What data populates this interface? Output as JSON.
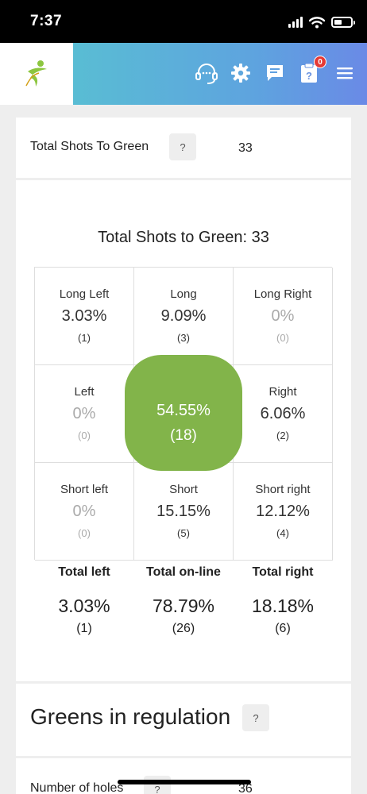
{
  "status_bar": {
    "time": "7:37"
  },
  "header": {
    "icons": [
      "logo-icon",
      "support-headset-icon",
      "gear-icon",
      "chat-icon",
      "help-clipboard-icon",
      "menu-icon"
    ],
    "notification_badge": "0",
    "brand_gradient": [
      "#57c7cf",
      "#6a8ae6"
    ]
  },
  "shots_row": {
    "label": "Total Shots To Green",
    "help": "?",
    "value": "33"
  },
  "chart_data": {
    "type": "table",
    "title": "Total Shots to Green: 33",
    "cells": [
      {
        "label": "Long Left",
        "pct": "3.03%",
        "count": "(1)"
      },
      {
        "label": "Long",
        "pct": "9.09%",
        "count": "(3)"
      },
      {
        "label": "Long Right",
        "pct": "0%",
        "count": "(0)"
      },
      {
        "label": "Left",
        "pct": "0%",
        "count": "(0)"
      },
      {
        "label": "",
        "pct": "54.55%",
        "count": "(18)"
      },
      {
        "label": "Right",
        "pct": "6.06%",
        "count": "(2)"
      },
      {
        "label": "Short left",
        "pct": "0%",
        "count": "(0)"
      },
      {
        "label": "Short",
        "pct": "15.15%",
        "count": "(5)"
      },
      {
        "label": "Short right",
        "pct": "12.12%",
        "count": "(4)"
      }
    ],
    "totals": [
      {
        "label": "Total left",
        "pct": "3.03%",
        "count": "(1)"
      },
      {
        "label": "Total on-line",
        "pct": "78.79%",
        "count": "(26)"
      },
      {
        "label": "Total right",
        "pct": "18.18%",
        "count": "(6)"
      }
    ],
    "highlight_color": "#82b44a"
  },
  "gir": {
    "title": "Greens in regulation",
    "help": "?",
    "row_label": "Number of holes",
    "row_help": "?",
    "row_value": "36"
  }
}
